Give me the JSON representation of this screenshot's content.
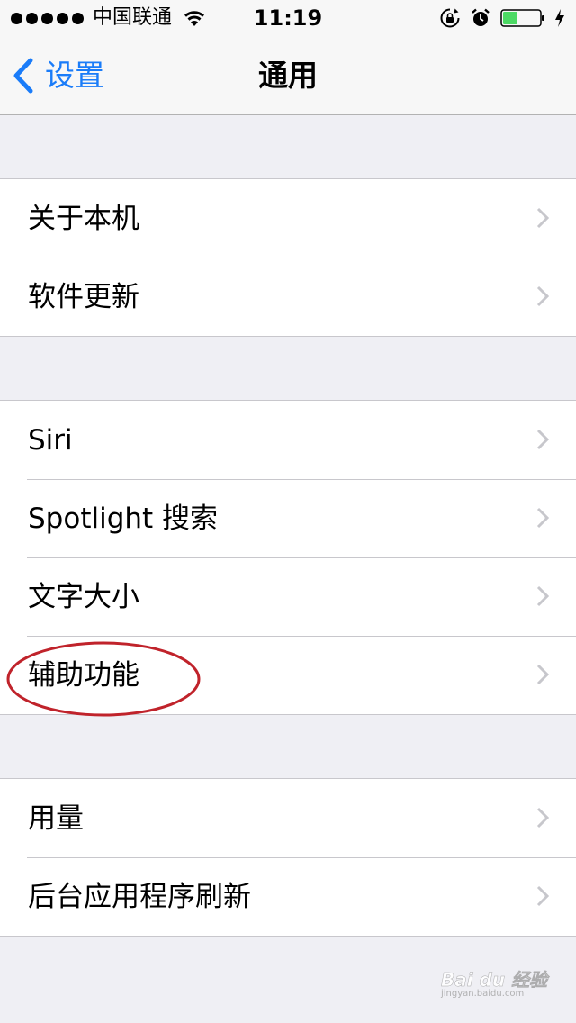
{
  "status_bar": {
    "carrier": "中国联通",
    "time": "11:19",
    "battery_level": 0.4,
    "icons": [
      "signal-dots-icon",
      "wifi-icon",
      "rotation-lock-icon",
      "alarm-icon",
      "battery-icon",
      "charging-bolt-icon"
    ]
  },
  "nav": {
    "back_label": "设置",
    "title": "通用"
  },
  "sections": [
    {
      "items": [
        {
          "label": "关于本机"
        },
        {
          "label": "软件更新"
        }
      ]
    },
    {
      "items": [
        {
          "label": "Siri"
        },
        {
          "label": "Spotlight 搜索"
        },
        {
          "label": "文字大小"
        },
        {
          "label": "辅助功能"
        }
      ]
    },
    {
      "items": [
        {
          "label": "用量"
        },
        {
          "label": "后台应用程序刷新"
        }
      ]
    }
  ],
  "annotation": {
    "highlighted_item": "辅助功能",
    "color": "#c0232b"
  },
  "watermark": {
    "text": "Bai du 经验",
    "subtext": "jingyan.baidu.com"
  },
  "colors": {
    "accent": "#1a7cf9",
    "background": "#efeff4",
    "separator": "#c8c7cc",
    "battery": "#4cd964"
  }
}
